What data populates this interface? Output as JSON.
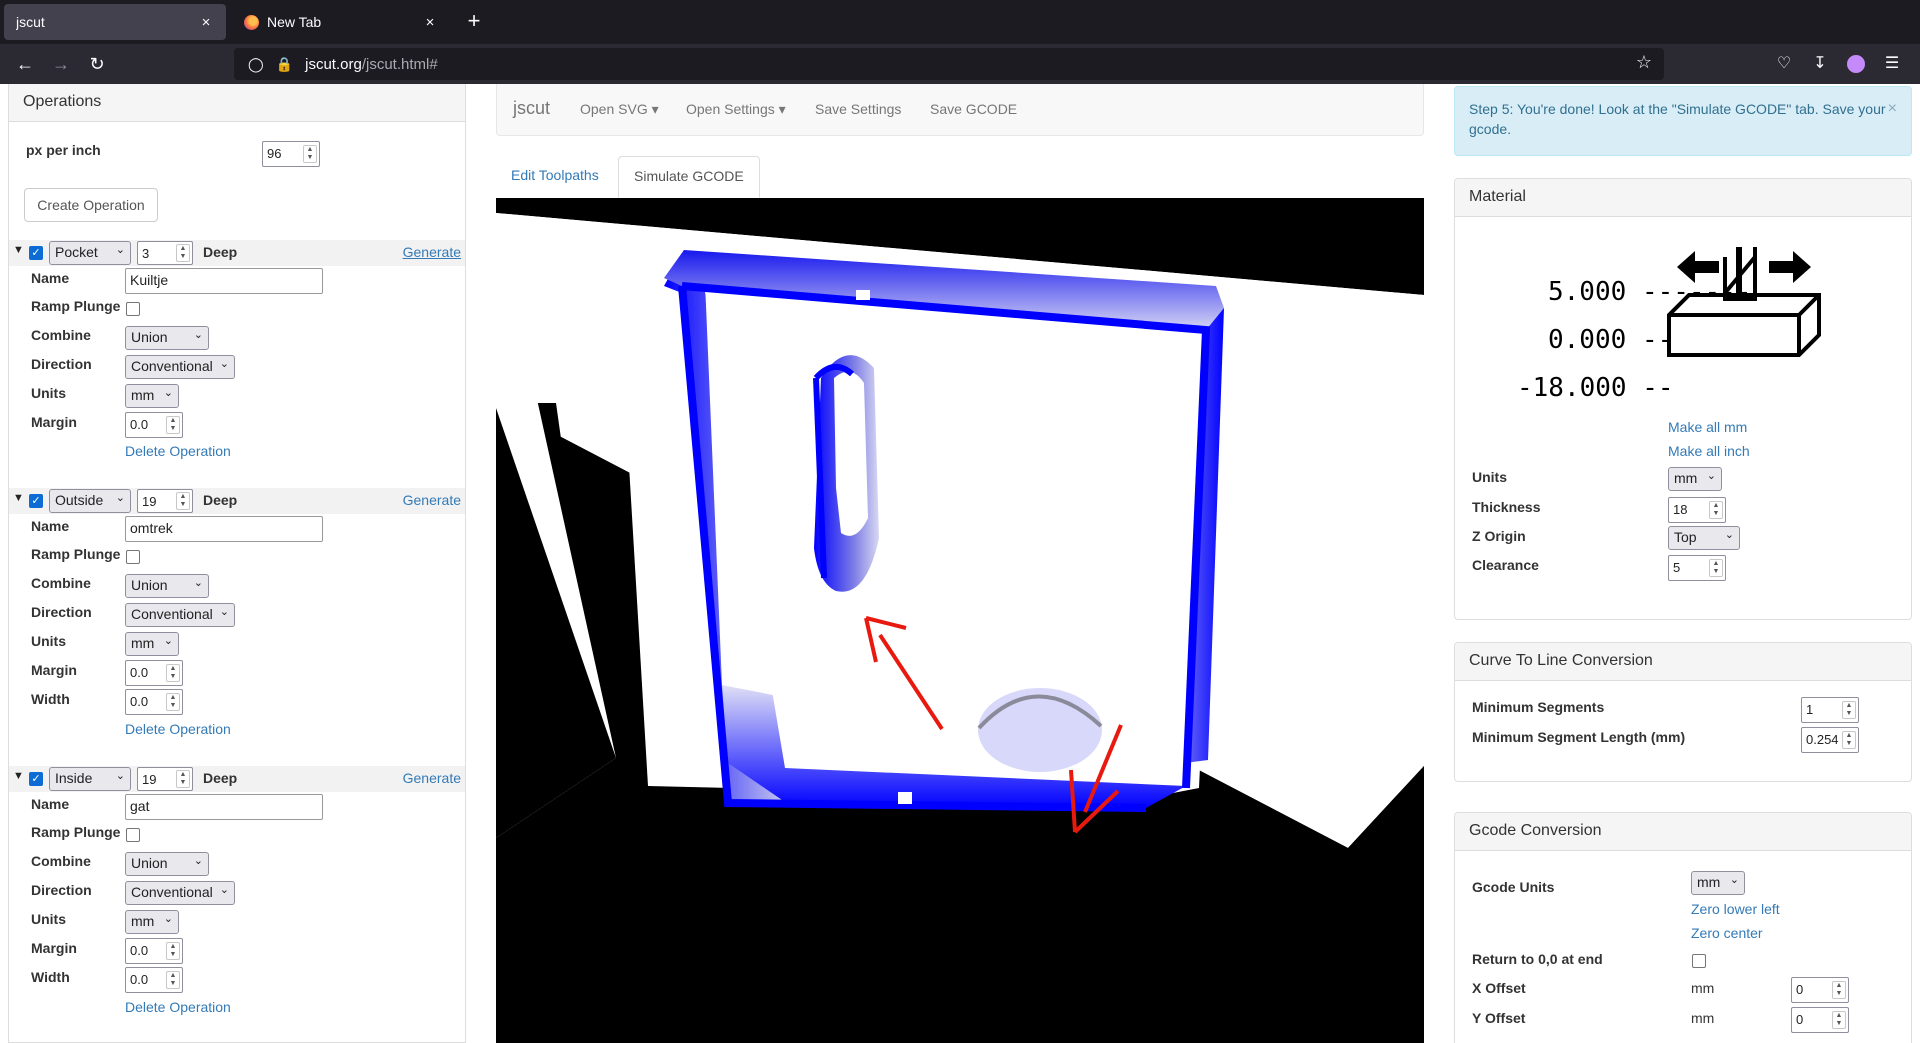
{
  "browser": {
    "tabs": [
      {
        "title": "jscut",
        "close": "×"
      },
      {
        "title": "New Tab",
        "close": "×"
      }
    ],
    "new_tab": "+",
    "url_host": "jscut.org",
    "url_path": "/jscut.html#"
  },
  "left": {
    "heading": "Operations",
    "px_per_inch_label": "px per inch",
    "px_per_inch_value": "96",
    "create_label": "Create Operation",
    "labels": {
      "name": "Name",
      "ramp": "Ramp Plunge",
      "combine": "Combine",
      "direction": "Direction",
      "units": "Units",
      "margin": "Margin",
      "width": "Width",
      "deep": "Deep",
      "generate": "Generate",
      "delete": "Delete Operation"
    },
    "ops": [
      {
        "type": "Pocket",
        "depth": "3",
        "name": "Kuiltje",
        "combine": "Union",
        "direction": "Conventional",
        "units": "mm",
        "margin": "0.0"
      },
      {
        "type": "Outside",
        "depth": "19",
        "name": "omtrek",
        "combine": "Union",
        "direction": "Conventional",
        "units": "mm",
        "margin": "0.0",
        "width": "0.0"
      },
      {
        "type": "Inside",
        "depth": "19",
        "name": "gat",
        "combine": "Union",
        "direction": "Conventional",
        "units": "mm",
        "margin": "0.0",
        "width": "0.0"
      }
    ]
  },
  "center": {
    "brand": "jscut",
    "menu": {
      "open_svg": "Open SVG",
      "open_settings": "Open Settings",
      "save_settings": "Save Settings",
      "save_gcode": "Save GCODE"
    },
    "tab_edit": "Edit Toolpaths",
    "tab_sim": "Simulate GCODE"
  },
  "right": {
    "alert": "Step 5: You're done! Look at the \"Simulate GCODE\" tab. Save your gcode.",
    "alert_close": "×",
    "material": {
      "heading": "Material",
      "diagram": {
        "top": "5.000",
        "top_dash": "-------",
        "mid": "0.000",
        "mid_dash": "--",
        "bot": "-18.000",
        "bot_dash": "--"
      },
      "make_mm": "Make all mm",
      "make_inch": "Make all inch",
      "units_label": "Units",
      "units": "mm",
      "thickness_label": "Thickness",
      "thickness": "18",
      "zorigin_label": "Z Origin",
      "zorigin": "Top",
      "clearance_label": "Clearance",
      "clearance": "5"
    },
    "curve": {
      "heading": "Curve To Line Conversion",
      "min_seg_label": "Minimum Segments",
      "min_seg": "1",
      "min_len_label": "Minimum Segment Length (mm)",
      "min_len": "0.254"
    },
    "gcode": {
      "heading": "Gcode Conversion",
      "units_label": "Gcode Units",
      "units": "mm",
      "zero_ll": "Zero lower left",
      "zero_center": "Zero center",
      "return_label": "Return to 0,0 at end",
      "xoff_label": "X Offset",
      "xoff_unit": "mm",
      "xoff": "0",
      "yoff_label": "Y Offset",
      "yoff_unit": "mm",
      "yoff": "0"
    }
  },
  "colors": {
    "link": "#337ab7",
    "cut": "#0000ff",
    "arrow": "#e8190f",
    "alert_bg": "#d9edf7"
  }
}
